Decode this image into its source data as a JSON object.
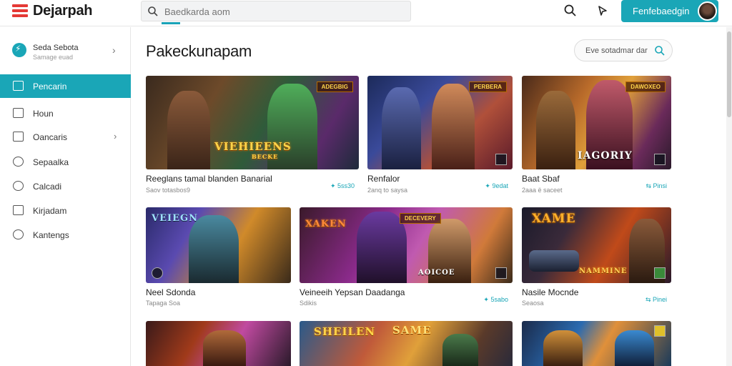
{
  "app": {
    "name": "Dejarpah"
  },
  "search": {
    "placeholder": "Baedkarda aom"
  },
  "header": {
    "signin_label": "Fenfebaedgin"
  },
  "sidebar": {
    "profile": {
      "name": "Seda Sebota",
      "sub": "Samage euad"
    },
    "items": [
      {
        "label": "Pencarin",
        "icon": "home-icon",
        "active": true
      },
      {
        "label": "Houn",
        "icon": "window-icon"
      },
      {
        "label": "Oancaris",
        "icon": "folder-icon",
        "chevron": true
      },
      {
        "label": "Sepaalka",
        "icon": "users-icon"
      },
      {
        "label": "Calcadi",
        "icon": "person-icon"
      },
      {
        "label": "Kirjadam",
        "icon": "book-icon"
      },
      {
        "label": "Kantengs",
        "icon": "chat-icon"
      }
    ]
  },
  "main": {
    "title": "Pakeckunapam",
    "filter_label": "Eve sotadmar dar",
    "cards": [
      {
        "title": "Reeglans tamal blanden Banarial",
        "sub": "Saov totasbos9",
        "meta": "✦ 5ss30",
        "art_text": "VIEHIEENS",
        "art_sub": "BECKE",
        "badge": "ADEGBIG"
      },
      {
        "title": "Renfalor",
        "sub": "2anq to saysa",
        "meta": "✦ 9edat",
        "art_text": "",
        "art_sub": "",
        "badge": "PERBERA"
      },
      {
        "title": "Baat Sbaf",
        "sub": "2aaa ë saceet",
        "meta": "⇆ Pinsi",
        "art_text": "IAGORIY",
        "art_sub": "",
        "badge": "DAWOXEO"
      },
      {
        "title": "Neel Sdonda",
        "sub": "Tapaga Soa",
        "meta": "",
        "art_text": "VEIEGN",
        "art_sub": "",
        "badge": ""
      },
      {
        "title": "Veineeih Yepsan Daadanga",
        "sub": "Sdikis",
        "meta": "✦ 5sabo",
        "art_text": "XAKEN",
        "art_sub": "AOICOE",
        "badge": "DECEVERY"
      },
      {
        "title": "Nasile Mocnde",
        "sub": "Seaosa",
        "meta": "⇆ Pinei",
        "art_text": "XAME",
        "art_sub": "NAMMINE",
        "badge": ""
      },
      {
        "title": "",
        "sub": "",
        "meta": "",
        "art_text": "",
        "art_sub": "",
        "badge": ""
      },
      {
        "title": "",
        "sub": "",
        "meta": "",
        "art_text": "SHEILEN",
        "art_sub": "SAME",
        "badge": ""
      },
      {
        "title": "",
        "sub": "",
        "meta": "",
        "art_text": "",
        "art_sub": "",
        "badge": ""
      }
    ]
  },
  "colors": {
    "accent": "#1aa6b7",
    "logo": "#e53935"
  }
}
